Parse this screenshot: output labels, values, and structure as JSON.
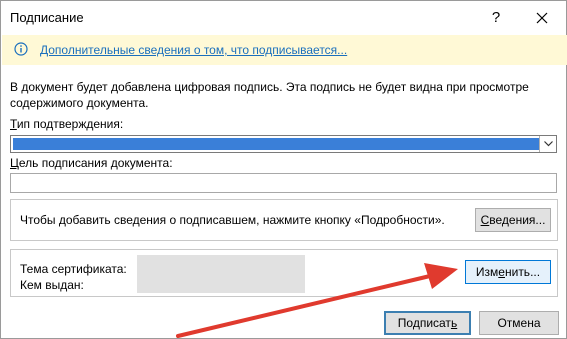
{
  "window": {
    "title": "Подписание",
    "help_glyph": "?"
  },
  "infobar": {
    "link": "Дополнительные сведения о том, что подписывается..."
  },
  "description": "В документ будет добавлена цифровая подпись. Эта подпись не будет видна при просмотре содержимого документа.",
  "commitment": {
    "label_mnemonic": "Т",
    "label_rest": "ип подтверждения:",
    "selected_value": ""
  },
  "purpose": {
    "label_mnemonic": "Ц",
    "label_rest": "ель подписания документа:",
    "value": ""
  },
  "signer_info": {
    "text": "Чтобы добавить сведения о подписавшем, нажмите кнопку «Подробности».",
    "button_mnemonic": "С",
    "button_rest": "ведения..."
  },
  "certificate": {
    "subject_label": "Тема сертификата:",
    "issuer_label": "Кем выдан:",
    "change_prefix": "Изм",
    "change_mnemonic": "е",
    "change_suffix": "нить..."
  },
  "actions": {
    "sign_prefix": "Подписат",
    "sign_mnemonic": "ь",
    "cancel_label": "Отмена"
  },
  "colors": {
    "infobar_bg": "#fff9d6",
    "link": "#1a6fbd",
    "selection": "#3a7fd8",
    "annotation_arrow": "#e03a2e"
  }
}
